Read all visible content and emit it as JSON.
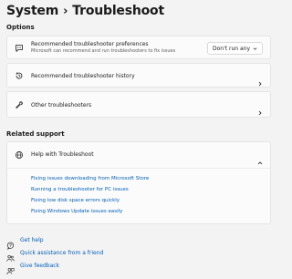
{
  "breadcrumb": {
    "parent": "System",
    "separator": "›",
    "current": "Troubleshoot"
  },
  "options": {
    "section_title": "Options",
    "preferences": {
      "title": "Recommended troubleshooter preferences",
      "subtitle": "Microsoft can recommend and run troubleshooters to fix issues",
      "dropdown_value": "Don't run any",
      "icon": "chat-icon"
    },
    "history": {
      "title": "Recommended troubleshooter history",
      "icon": "history-icon"
    },
    "other": {
      "title": "Other troubleshooters",
      "icon": "wrench-icon"
    }
  },
  "related_support": {
    "section_title": "Related support",
    "help": {
      "title": "Help with Troubleshoot",
      "icon": "globe-icon",
      "links": [
        "Fixing issues downloading from Microsoft Store",
        "Running a troubleshooter for PC issues",
        "Fixing low disk space errors quickly",
        "Fixing Windows Update issues easily"
      ]
    }
  },
  "footer": {
    "get_help": "Get help",
    "quick_assist": "Quick assistance from a friend",
    "feedback": "Give feedback"
  },
  "colors": {
    "accent": "#005fb8",
    "background": "#f3f3f3",
    "card": "#fbfbfb"
  }
}
